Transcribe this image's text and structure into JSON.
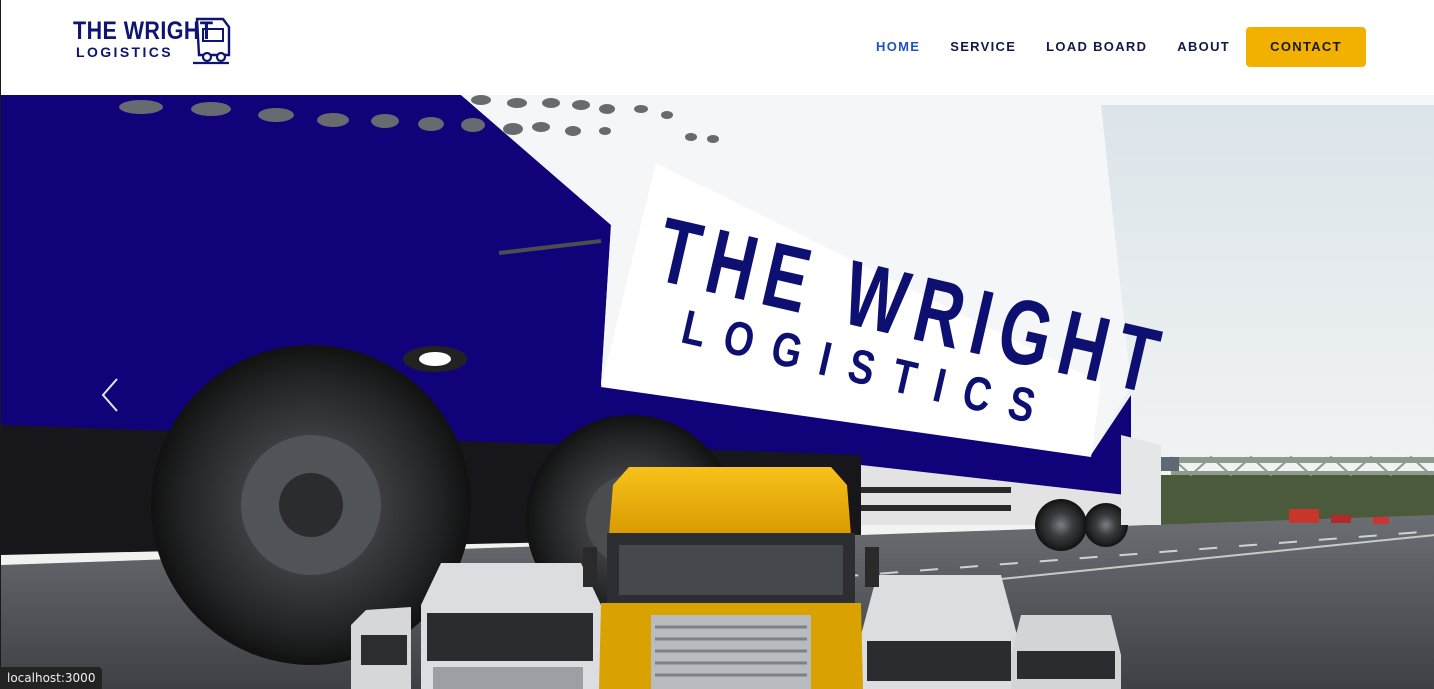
{
  "brand": {
    "line1": "THE WRIGHT",
    "line2": "LOGISTICS",
    "color": "#0d1570"
  },
  "nav": {
    "items": [
      {
        "label": "HOME",
        "active": true
      },
      {
        "label": "SERVICE",
        "active": false
      },
      {
        "label": "LOAD BOARD",
        "active": false
      },
      {
        "label": "ABOUT",
        "active": false
      }
    ],
    "contact_label": "CONTACT",
    "contact_color": "#f2b000",
    "active_color": "#1f54b8"
  },
  "hero": {
    "trailer_title": "THE WRIGHT",
    "trailer_subtitle": "LOGISTICS",
    "prev_icon": "chevron-left-icon",
    "trailer_color": "#10037a"
  },
  "status_bar": {
    "url": "localhost:3000"
  }
}
